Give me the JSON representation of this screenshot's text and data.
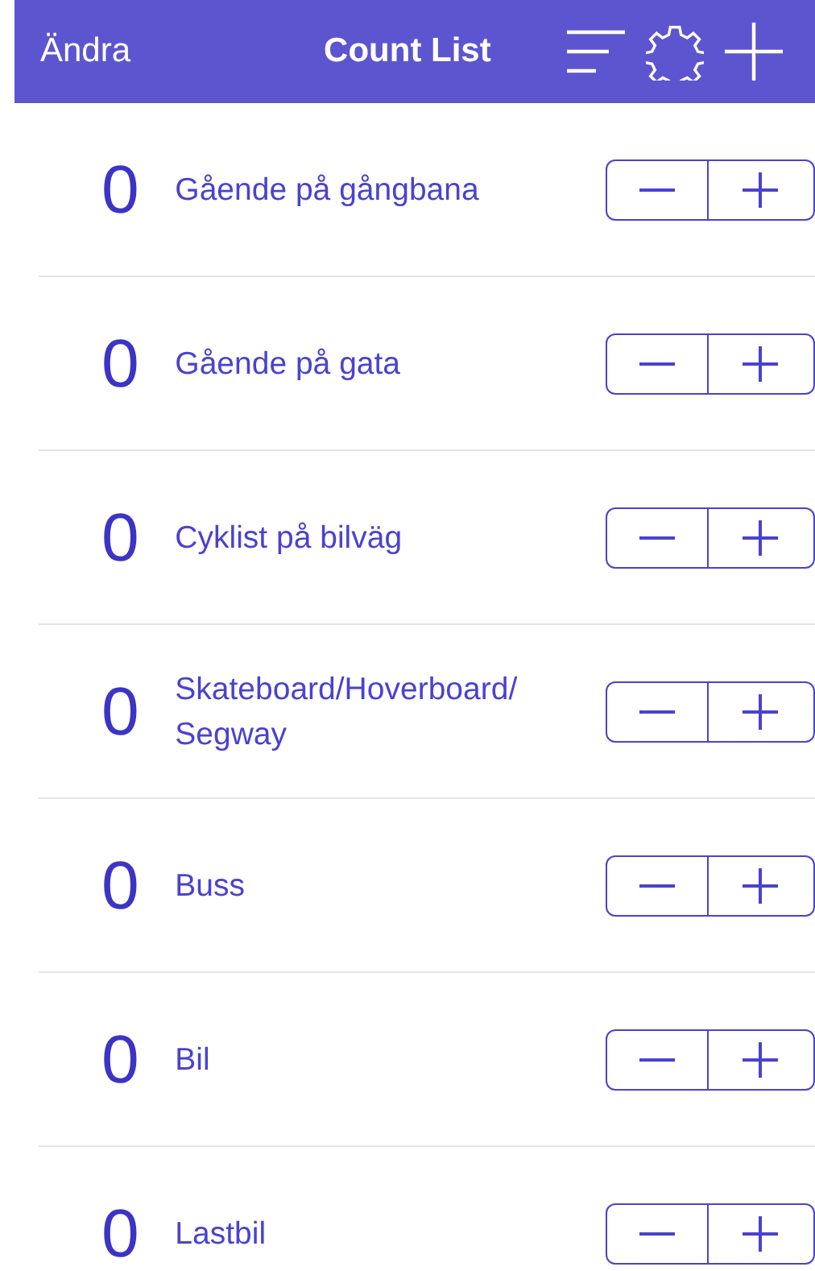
{
  "nav_bar": {
    "left_button": "Ändra",
    "title": "Count List"
  },
  "counters": [
    {
      "count": "0",
      "label": "Gående på gångbana"
    },
    {
      "count": "0",
      "label": "Gående på gata"
    },
    {
      "count": "0",
      "label": "Cyklist på bilväg"
    },
    {
      "count": "0",
      "label": "Skateboard/Hoverboard/ Segway"
    },
    {
      "count": "0",
      "label": "Buss"
    },
    {
      "count": "0",
      "label": "Bil"
    },
    {
      "count": "0",
      "label": "Lastbil"
    }
  ]
}
